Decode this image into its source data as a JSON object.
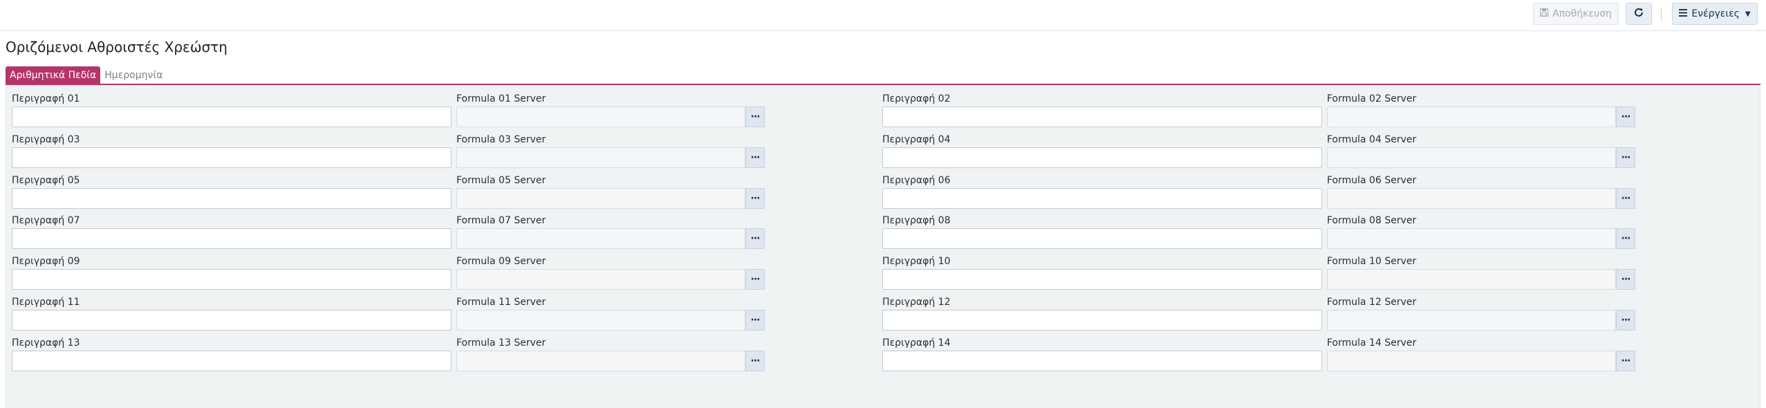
{
  "toolbar": {
    "save_label": "Αποθήκευση",
    "actions_label": "Ενέργειες",
    "icons": {
      "save": "floppy-disk-icon",
      "refresh": "refresh-icon",
      "actions": "hamburger-menu-icon",
      "caret": "caret-down-icon"
    }
  },
  "page": {
    "title": "Οριζόμενοι Αθροιστές Χρεώστη"
  },
  "tabs": [
    {
      "label": "Αριθμητικά Πεδία",
      "active": true
    },
    {
      "label": "Ημερομηνία",
      "active": false
    }
  ],
  "form": {
    "rows": [
      {
        "left": {
          "desc_label": "Περιγραφή 01",
          "formula_label": "Formula 01 Server"
        },
        "right": {
          "desc_label": "Περιγραφή 02",
          "formula_label": "Formula 02 Server"
        }
      },
      {
        "left": {
          "desc_label": "Περιγραφή 03",
          "formula_label": "Formula 03 Server"
        },
        "right": {
          "desc_label": "Περιγραφή 04",
          "formula_label": "Formula 04 Server"
        }
      },
      {
        "left": {
          "desc_label": "Περιγραφή 05",
          "formula_label": "Formula 05 Server"
        },
        "right": {
          "desc_label": "Περιγραφή 06",
          "formula_label": "Formula 06 Server"
        }
      },
      {
        "left": {
          "desc_label": "Περιγραφή 07",
          "formula_label": "Formula 07 Server"
        },
        "right": {
          "desc_label": "Περιγραφή 08",
          "formula_label": "Formula 08 Server"
        }
      },
      {
        "left": {
          "desc_label": "Περιγραφή 09",
          "formula_label": "Formula 09 Server"
        },
        "right": {
          "desc_label": "Περιγραφή 10",
          "formula_label": "Formula 10 Server"
        }
      },
      {
        "left": {
          "desc_label": "Περιγραφή 11",
          "formula_label": "Formula 11 Server"
        },
        "right": {
          "desc_label": "Περιγραφή 12",
          "formula_label": "Formula 12 Server"
        }
      },
      {
        "left": {
          "desc_label": "Περιγραφή 13",
          "formula_label": "Formula 13 Server"
        },
        "right": {
          "desc_label": "Περιγραφή 14",
          "formula_label": "Formula 14 Server"
        }
      }
    ],
    "picker_label": "···"
  }
}
